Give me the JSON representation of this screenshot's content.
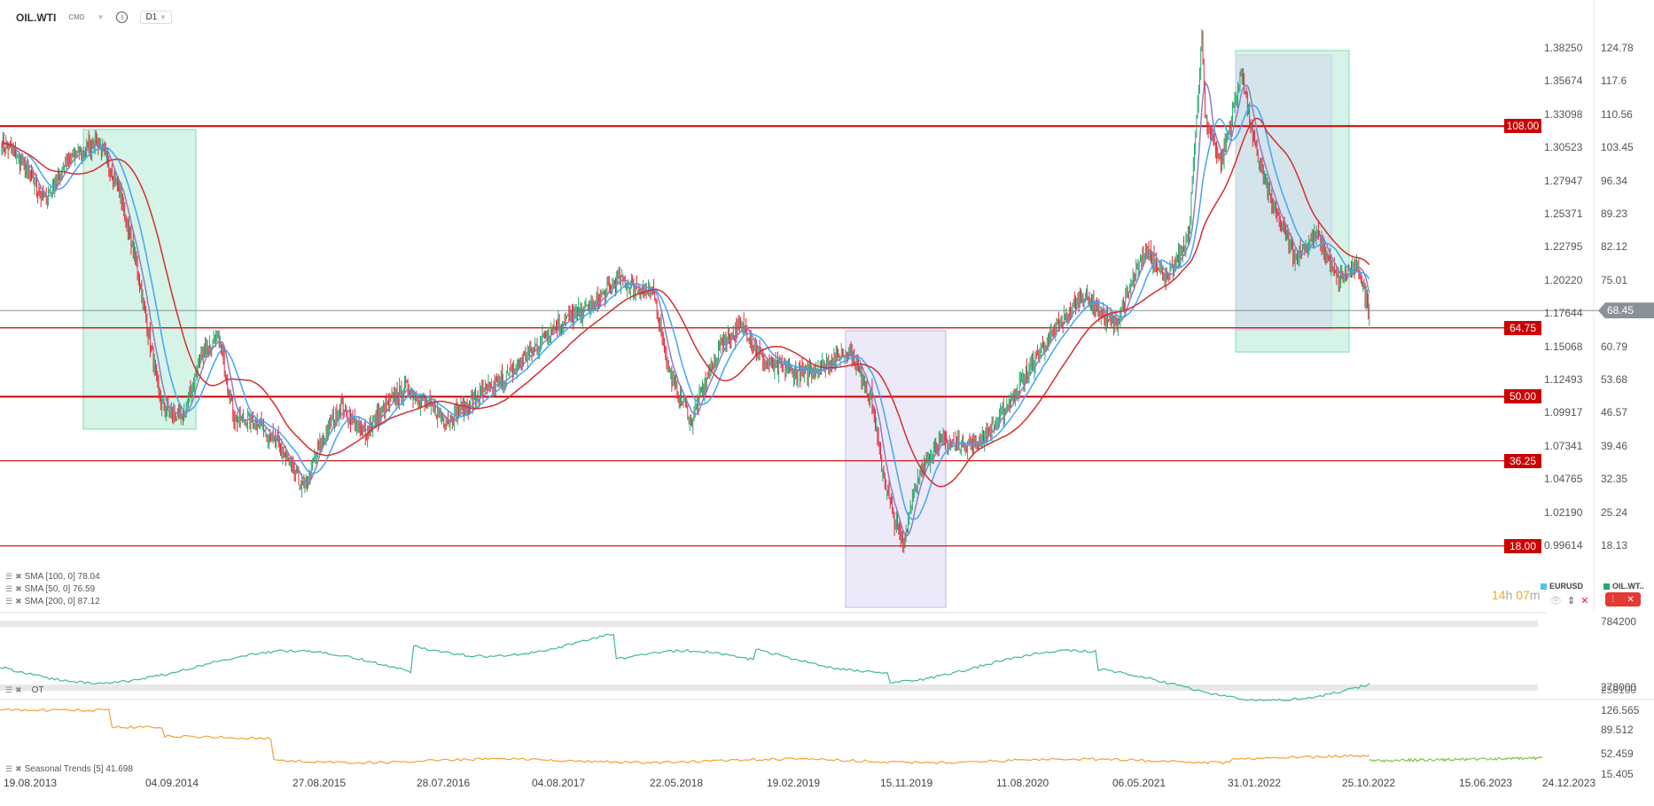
{
  "header": {
    "symbol": "OIL.WTI",
    "market": "CMD",
    "info_icon": "i",
    "timeframe": "D1"
  },
  "eurusd_axis": [
    "1.38250",
    "1.35674",
    "1.33098",
    "1.30523",
    "1.27947",
    "1.25371",
    "1.22795",
    "1.20220",
    "1.17644",
    "1.15068",
    "1.12493",
    "1.09917",
    "1.07341",
    "1.04765",
    "1.02190",
    "0.99614"
  ],
  "price_axis": [
    "124.78",
    "117.6",
    "110.56",
    "103.45",
    "96.34",
    "89.23",
    "82.12",
    "75.01",
    "68.45",
    "60.79",
    "53.68",
    "46.57",
    "39.46",
    "32.35",
    "25.24",
    "18.13"
  ],
  "price_range": [
    18.13,
    124.78
  ],
  "current_price": "68.45",
  "levels": [
    {
      "label": "108.00",
      "value": 108
    },
    {
      "label": "64.75",
      "value": 64.75
    },
    {
      "label": "50.00",
      "value": 50
    },
    {
      "label": "36.25",
      "value": 36.25
    },
    {
      "label": "18.00",
      "value": 18
    }
  ],
  "indicators": [
    "SMA [100, 0] 78.04",
    "SMA [50, 0] 76.59",
    "SMA [200, 0] 87.12"
  ],
  "countdown": {
    "hours": "14",
    "h": "h",
    "minutes": "07",
    "m": "m"
  },
  "series_legend": [
    {
      "name": "EURUSD",
      "color": "#4fc3f7"
    },
    {
      "name": "OIL.WT..",
      "color": "#26a96c"
    }
  ],
  "panel1": {
    "label": "OT",
    "axis": [
      "784200",
      "278000",
      "258100"
    ]
  },
  "panel2": {
    "label": "Seasonal  Trends  [5]  41.698",
    "axis": [
      "126.565",
      "89.512",
      "52.459",
      "15.405"
    ]
  },
  "x_axis": [
    "19.08.2013",
    "04.09.2014",
    "27.08.2015",
    "28.07.2016",
    "04.08.2017",
    "22.05.2018",
    "19.02.2019",
    "15.11.2019",
    "11.08.2020",
    "06.05.2021",
    "31.01.2022",
    "25.10.2022",
    "15.06.2023",
    "24.12.2023"
  ],
  "colors": {
    "up": "#26a96c",
    "down": "#e0293b",
    "sma_short": "#8e7cc3",
    "sma_mid": "#42a5f5",
    "sma_long": "#d32f2f",
    "level": "#cc0000"
  },
  "chart_data": {
    "type": "candlestick",
    "unit": "bar_index",
    "price_anchors": [
      [
        0,
        105
      ],
      [
        40,
        100
      ],
      [
        80,
        92
      ],
      [
        120,
        100
      ],
      [
        180,
        105
      ],
      [
        220,
        95
      ],
      [
        260,
        75
      ],
      [
        300,
        48
      ],
      [
        340,
        45
      ],
      [
        380,
        60
      ],
      [
        410,
        62
      ],
      [
        440,
        45
      ],
      [
        480,
        45
      ],
      [
        520,
        40
      ],
      [
        570,
        30
      ],
      [
        600,
        40
      ],
      [
        640,
        48
      ],
      [
        680,
        42
      ],
      [
        760,
        52
      ],
      [
        840,
        45
      ],
      [
        900,
        50
      ],
      [
        960,
        55
      ],
      [
        1040,
        65
      ],
      [
        1120,
        70
      ],
      [
        1160,
        75
      ],
      [
        1230,
        72
      ],
      [
        1260,
        55
      ],
      [
        1300,
        45
      ],
      [
        1360,
        62
      ],
      [
        1400,
        65
      ],
      [
        1440,
        57
      ],
      [
        1520,
        55
      ],
      [
        1600,
        60
      ],
      [
        1640,
        50
      ],
      [
        1660,
        35
      ],
      [
        1680,
        25
      ],
      [
        1700,
        18
      ],
      [
        1720,
        30
      ],
      [
        1760,
        40
      ],
      [
        1840,
        40
      ],
      [
        1880,
        45
      ],
      [
        1960,
        60
      ],
      [
        2040,
        72
      ],
      [
        2100,
        65
      ],
      [
        2160,
        82
      ],
      [
        2200,
        75
      ],
      [
        2240,
        85
      ],
      [
        2264,
        128
      ],
      [
        2270,
        110
      ],
      [
        2300,
        100
      ],
      [
        2340,
        120
      ],
      [
        2360,
        105
      ],
      [
        2400,
        90
      ],
      [
        2440,
        80
      ],
      [
        2480,
        85
      ],
      [
        2520,
        75
      ],
      [
        2560,
        78
      ],
      [
        2580,
        68
      ]
    ]
  }
}
